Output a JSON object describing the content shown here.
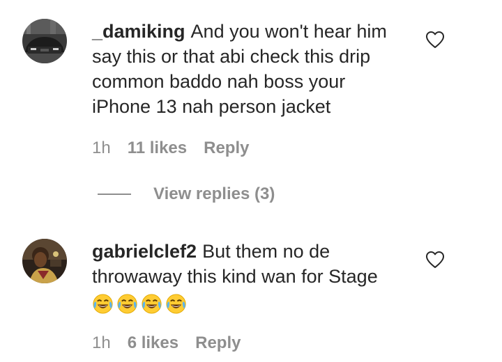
{
  "comments": [
    {
      "username": "_damiking",
      "text": "And you won't hear him say this or that abi check this drip common baddo nah boss your iPhone 13 nah person jacket",
      "time": "1h",
      "likes": "11 likes",
      "reply_label": "Reply",
      "avatar_icon": "car-photo-avatar"
    },
    {
      "username": "gabrielclef2",
      "text": "But them no de throwaway this kind wan for Stage",
      "emoji": [
        "😂",
        "😂",
        "😂",
        "😂"
      ],
      "time": "1h",
      "likes": "6 likes",
      "reply_label": "Reply",
      "avatar_icon": "person-photo-avatar"
    }
  ],
  "view_replies_label": "View replies (3)",
  "colors": {
    "text": "#262626",
    "secondary": "#8e8e8e",
    "background": "#ffffff"
  },
  "icons": {
    "like": "heart-outline-icon",
    "emoji": "face-with-tears-of-joy-emoji"
  }
}
